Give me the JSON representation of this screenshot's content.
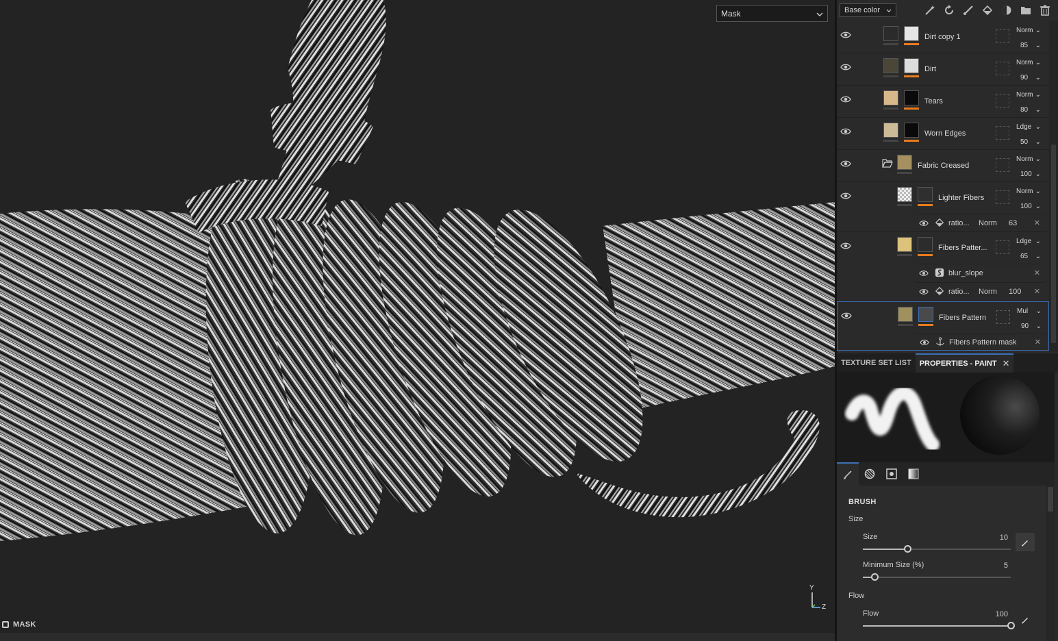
{
  "viewport": {
    "channel_select": "Mask",
    "mode_label": "MASK",
    "gizmo": {
      "y": "Y",
      "z": "Z"
    }
  },
  "toolbar": {
    "channel": "Base color",
    "icons": [
      "magic-wand-icon",
      "rotate-icon",
      "brush-icon",
      "fill-icon",
      "smart-material-icon",
      "folder-icon",
      "trash-icon"
    ]
  },
  "layers": [
    {
      "name": "Dirt copy 1",
      "blend": "Norm",
      "opacity": "85",
      "color1": "#2b2b2b",
      "color2": "#e6e6e6"
    },
    {
      "name": "Dirt",
      "blend": "Norm",
      "opacity": "90",
      "color1": "#4a4638",
      "color2": "#dcdcdc"
    },
    {
      "name": "Tears",
      "blend": "Norm",
      "opacity": "80",
      "color1": "#d8b88a",
      "color2": "#0a0a0a"
    },
    {
      "name": "Worn Edges",
      "blend": "Ldge",
      "opacity": "50",
      "color1": "#cdbb98",
      "color2": "#0a0a0a"
    },
    {
      "name": "Fabric Creased",
      "blend": "Norm",
      "opacity": "100",
      "color1": "#a69060"
    },
    {
      "name": "Lighter Fibers",
      "blend": "Norm",
      "opacity": "100",
      "color1": "checker",
      "color2": "#2f2f2f"
    },
    {
      "name": "Fibers Patter...",
      "blend": "Ldge",
      "opacity": "65",
      "color1": "#dcc27a",
      "color2": "#2c2c2c"
    },
    {
      "name": "Fibers Pattern",
      "blend": "Mul",
      "opacity": "90",
      "color1": "#a0905e",
      "color2": "#4a4a4a"
    }
  ],
  "sublayers": {
    "lighter_ratio": {
      "label": "ratio...",
      "blend": "Norm",
      "value": "63"
    },
    "blur": {
      "label": "blur_slope"
    },
    "fibers_ratio": {
      "label": "ratio...",
      "blend": "Norm",
      "value": "100"
    },
    "mask": {
      "label": "Fibers Pattern mask"
    }
  },
  "tabs": {
    "texture_set": "TEXTURE SET LIST",
    "properties": "PROPERTIES - PAINT",
    "close": "✕"
  },
  "brush": {
    "section": "BRUSH",
    "size_group": "Size",
    "size_label": "Size",
    "size_value": "10",
    "size_fraction": 0.3,
    "min_size_label": "Minimum Size (%)",
    "min_size_value": "5",
    "min_size_fraction": 0.08,
    "flow_group": "Flow",
    "flow_label": "Flow",
    "flow_value": "100",
    "flow_fraction": 1.0
  },
  "colors": {
    "accent": "#3d6fb5",
    "mask_bar": "#e87b1f"
  }
}
